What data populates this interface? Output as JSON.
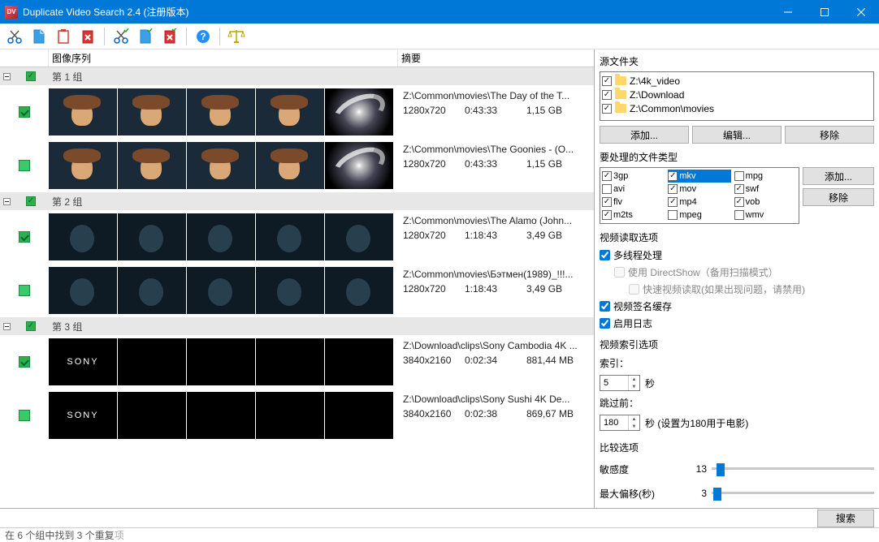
{
  "title": "Duplicate Video Search 2.4 (注册版本)",
  "columns": {
    "images": "图像序列",
    "summary": "摘要"
  },
  "groups": [
    {
      "label": "第 1 组",
      "items": [
        {
          "checked": true,
          "thumbs": [
            "man",
            "man",
            "man",
            "man",
            "galaxy"
          ],
          "path": "Z:\\Common\\movies\\The Day of the T...",
          "res": "1280x720",
          "dur": "0:43:33",
          "size": "1,15 GB"
        },
        {
          "checked": false,
          "greenish": true,
          "thumbs": [
            "man",
            "man",
            "man",
            "man",
            "galaxy"
          ],
          "path": "Z:\\Common\\movies\\The Goonies - (O...",
          "res": "1280x720",
          "dur": "0:43:33",
          "size": "1,15 GB"
        }
      ]
    },
    {
      "label": "第 2 组",
      "items": [
        {
          "checked": true,
          "thumbs": [
            "dark",
            "dark",
            "dark",
            "dark",
            "dark"
          ],
          "path": "Z:\\Common\\movies\\The Alamo (John...",
          "res": "1280x720",
          "dur": "1:18:43",
          "size": "3,49 GB"
        },
        {
          "checked": false,
          "greenish": true,
          "thumbs": [
            "dark",
            "dark",
            "dark",
            "dark",
            "dark"
          ],
          "path": "Z:\\Common\\movies\\Бэтмен(1989)_!!!...",
          "res": "1280x720",
          "dur": "1:18:43",
          "size": "3,49 GB"
        }
      ]
    },
    {
      "label": "第 3 组",
      "items": [
        {
          "checked": true,
          "thumbs": [
            "black SONY",
            "black",
            "black",
            "black",
            "black"
          ],
          "path": "Z:\\Download\\clips\\Sony Cambodia 4K ...",
          "res": "3840x2160",
          "dur": "0:02:34",
          "size": "881,44 MB"
        },
        {
          "checked": false,
          "greenish": true,
          "thumbs": [
            "black SONY",
            "black",
            "black",
            "black",
            "black"
          ],
          "path": "Z:\\Download\\clips\\Sony Sushi 4K De...",
          "res": "3840x2160",
          "dur": "0:02:38",
          "size": "869,67 MB"
        }
      ]
    }
  ],
  "right": {
    "src_label": "源文件夹",
    "sources": [
      "Z:\\4k_video",
      "Z:\\Download",
      "Z:\\Common\\movies"
    ],
    "btn_add": "添加...",
    "btn_edit": "编辑...",
    "btn_remove": "移除",
    "filetypes_label": "要处理的文件类型",
    "filetypes": [
      {
        "n": "3gp",
        "c": true
      },
      {
        "n": "mkv",
        "c": true,
        "sel": true
      },
      {
        "n": "mpg",
        "c": false
      },
      {
        "n": "avi",
        "c": false
      },
      {
        "n": "mov",
        "c": true
      },
      {
        "n": "swf",
        "c": true
      },
      {
        "n": "flv",
        "c": true
      },
      {
        "n": "mp4",
        "c": true
      },
      {
        "n": "vob",
        "c": true
      },
      {
        "n": "m2ts",
        "c": true
      },
      {
        "n": "mpeg",
        "c": false
      },
      {
        "n": "wmv",
        "c": false
      }
    ],
    "ft_add": "添加...",
    "ft_remove": "移除",
    "read_opts_label": "视频读取选项",
    "opt_multithread": "多线程处理",
    "opt_directshow": "使用 DirectShow（备用扫描模式）",
    "opt_fastread": "快速视频读取(如果出现问题，请禁用)",
    "opt_sigcache": "视频签名缓存",
    "opt_log": "启用日志",
    "index_label": "视频索引选项",
    "index_idx": "索引：",
    "index_val": "5",
    "sec": "秒",
    "skip_first": "跳过前：",
    "skip_val": "180",
    "skip_note": "秒 (设置为180用于电影)",
    "compare_label": "比较选项",
    "sensitivity": "敏感度",
    "sensitivity_val": "13",
    "maxoffset": "最大偏移(秒)",
    "maxoffset_val": "3",
    "search": "搜索"
  },
  "status_a": "在 6 个组中找到 3 个重复",
  "status_b": "项"
}
